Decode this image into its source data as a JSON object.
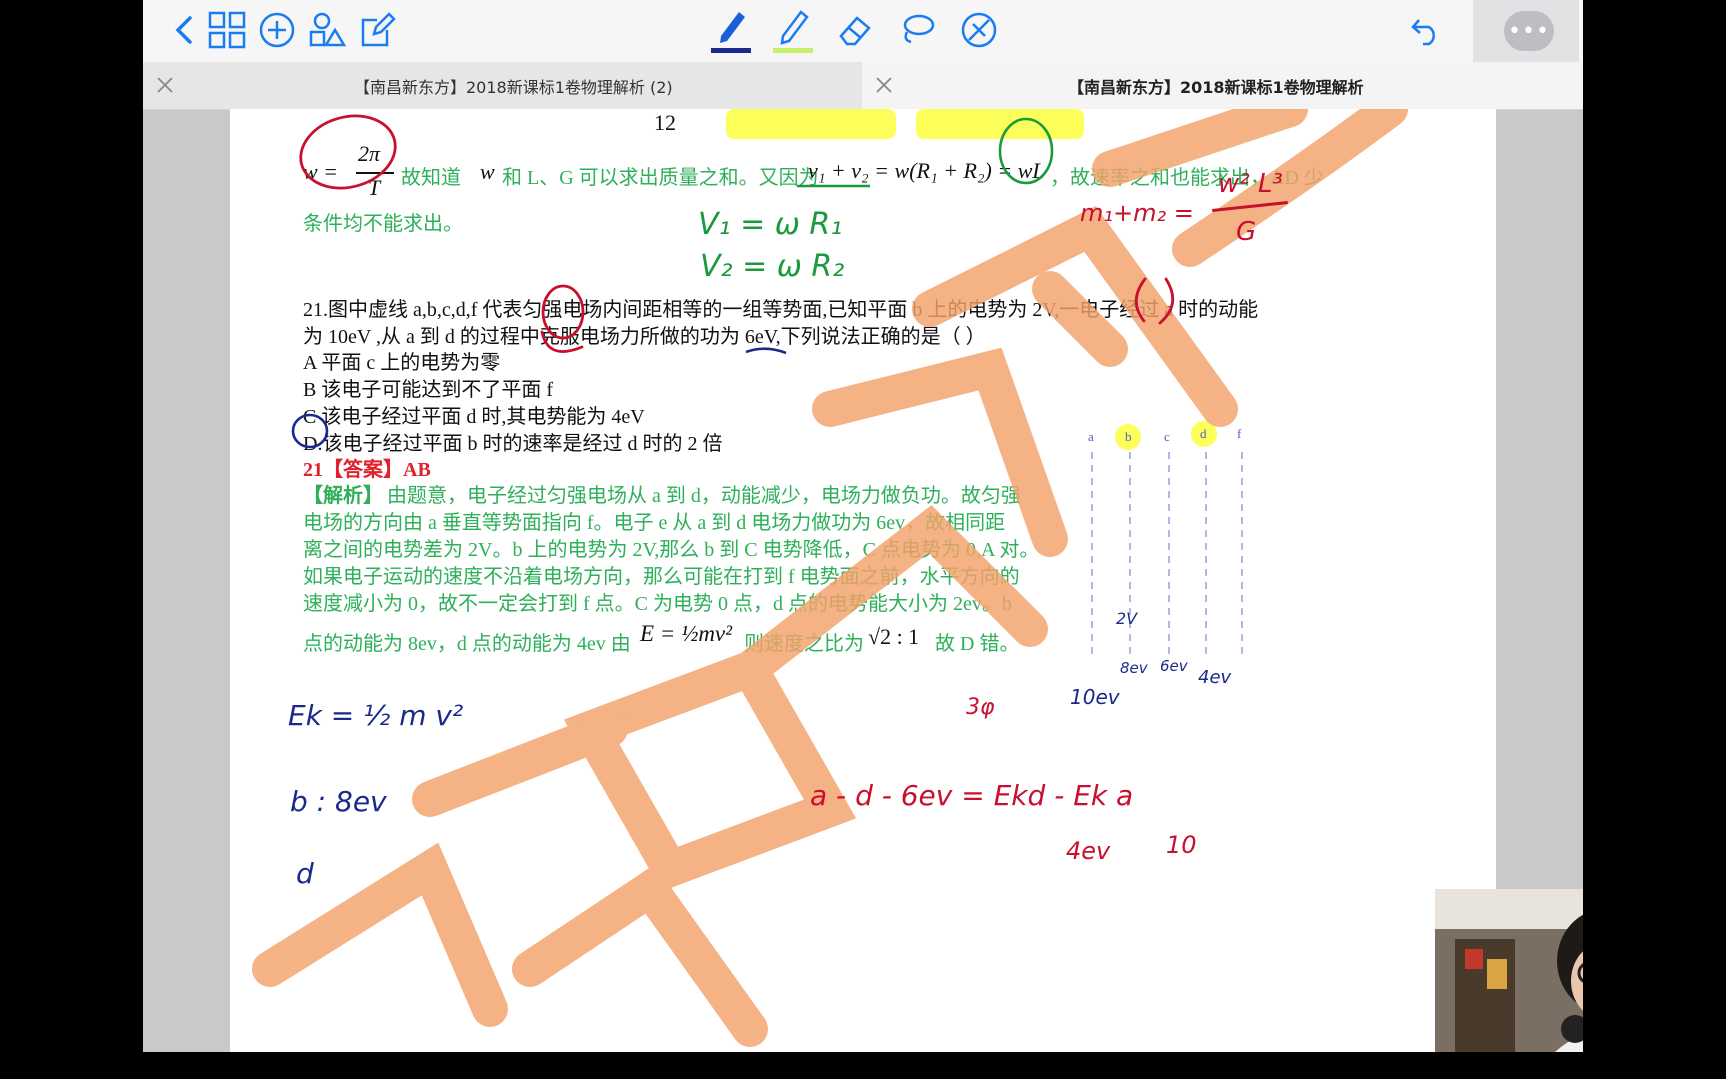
{
  "tabs": [
    {
      "title": "【南昌新东方】2018新课标1卷物理解析 (2)"
    },
    {
      "title": "【南昌新东方】2018新课标1卷物理解析"
    }
  ],
  "page": {
    "top_fragment": "12",
    "prev_line_a": "故知道",
    "prev_w": "w",
    "prev_line_b": "和 L、G 可以求出质量之和。又因为",
    "prev_eq": "v₁ + v₂ = w(R₁ + R₂) = wL",
    "prev_line_c": "，故速率之和也能求出，AD 少",
    "prev_line_d": "条件均不能求出。",
    "frac_num": "2π",
    "frac_den": "T",
    "w_eq": "w =",
    "q21_line1": "21.图中虚线 a,b,c,d,f 代表匀强电场内间距相等的一组等势面,已知平面 b 上的电势为 2V,一电子经过 a 时的动能",
    "q21_line2": "为 10eV ,从 a 到 d 的过程中克服电场力所做的功为 6eV,下列说法正确的是（      ）",
    "optA": "A  平面 c 上的电势为零",
    "optB": "B 该电子可能达到不了平面 f",
    "optC": "C  该电子经过平面 d 时,其电势能为 4eV",
    "optD": "D.该电子经过平面 b 时的速率是经过 d 时的 2 倍",
    "answer": "21【答案】AB",
    "exp_tag": "【解析】",
    "exp1": "由题意，电子经过匀强电场从 a 到 d，动能减少，电场力做负功。故匀强",
    "exp2": "电场的方向由 a 垂直等势面指向 f。电子 e 从 a 到 d 电场力做功为 6ev，故相同距",
    "exp3": "离之间的电势差为 2V。b 上的电势为 2V,那么 b 到 C 电势降低，C 点电势为 0,A 对。",
    "exp4": "如果电子运动的速度不沿着电场方向，那么可能在打到 f 电势面之前，水平方向的",
    "exp5": "速度减小为 0，故不一定会打到 f 点。C 为电势 0 点，d 点的电势能大小为 2ev。b",
    "exp6a": "点的动能为 8ev，d 点的动能为 4ev  由",
    "exp6eq": "E = ½mv²",
    "exp6b": "则速度之比为",
    "exp6c": "√2 : 1",
    "exp6d": "故 D 错。",
    "plane_labels": [
      "a",
      "b",
      "c",
      "d",
      "f"
    ]
  },
  "ink": {
    "v1": "V₁ = ω R₁",
    "v2": "V₂ = ω R₂",
    "mass": "m₁+m₂ =",
    "mass_num": "w² L³",
    "mass_den": "G",
    "ek": "Ek = ½ m v²",
    "b8": "b : 8ev",
    "d": "d",
    "v2label": "2V",
    "ev8": "8ev",
    "ev6": "6ev",
    "ev4": "4ev",
    "ev10": "10ev",
    "phi": "3φ",
    "ad": "a - d   - 6ev =  Ekd - Ek a",
    "ev4b": "4ev",
    "ev10b": "10"
  },
  "colors": {
    "green": "#2eb05a",
    "red_ink": "#c8102e",
    "blue_ink": "#1a2a8c",
    "watermark": "#f4a26a",
    "highlight": "#fbff3c"
  }
}
